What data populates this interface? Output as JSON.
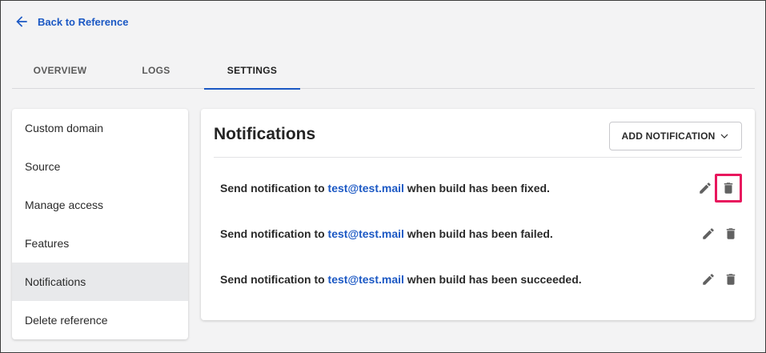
{
  "header": {
    "back_label": "Back to Reference",
    "tabs": [
      {
        "label": "OVERVIEW"
      },
      {
        "label": "LOGS"
      },
      {
        "label": "SETTINGS"
      }
    ]
  },
  "sidebar": {
    "items": [
      {
        "label": "Custom domain"
      },
      {
        "label": "Source"
      },
      {
        "label": "Manage access"
      },
      {
        "label": "Features"
      },
      {
        "label": "Notifications"
      },
      {
        "label": "Delete reference"
      }
    ]
  },
  "panel": {
    "title": "Notifications",
    "add_button_label": "ADD NOTIFICATION",
    "rows": [
      {
        "prefix": "Send notification to",
        "email": "test@test.mail",
        "suffix": "when build has been fixed."
      },
      {
        "prefix": "Send notification to",
        "email": "test@test.mail",
        "suffix": "when build has been failed."
      },
      {
        "prefix": "Send notification to",
        "email": "test@test.mail",
        "suffix": "when build has been succeeded."
      }
    ]
  },
  "icons": {
    "back": "arrow-left-icon",
    "dropdown": "chevron-down-icon",
    "edit": "pencil-icon",
    "delete": "trash-icon"
  },
  "colors": {
    "accent": "#1b58c4",
    "highlight": "#e8175d",
    "selected_bg": "#e8e9eb"
  }
}
